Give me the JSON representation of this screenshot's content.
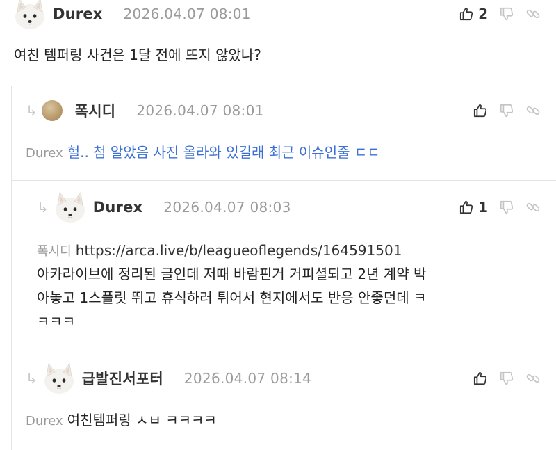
{
  "comments": [
    {
      "author": "Durex",
      "date": "2026.04.07 08:01",
      "like_count": "2",
      "text": "여친 템퍼링 사건은 1달 전에 뜨지 않았나?"
    },
    {
      "author": "폭시디",
      "date": "2026.04.07 08:01",
      "mention": "Durex",
      "text": "헐.. 첨 알았음 사진 올라와 있길래 최근 이슈인줄 ㄷㄷ"
    },
    {
      "author": "Durex",
      "date": "2026.04.07 08:03",
      "like_count": "1",
      "mention": "폭시디",
      "link": "https://arca.live/b/leagueoflegends/164591501",
      "lines": [
        "아카라이브에 정리된 글인데 저때 바람핀거 거피셜되고 2년 계약 박",
        "아놓고 1스플릿 뛰고 휴식하러 튀어서 현지에서도 반응 안좋던데 ㅋ",
        "ㅋㅋㅋ"
      ]
    },
    {
      "author": "급발진서포터",
      "date": "2026.04.07 08:14",
      "mention": "Durex",
      "text": "여친템퍼링 ㅅㅂ ㅋㅋㅋㅋ"
    }
  ],
  "icons": {
    "like": "thumbs-up-icon",
    "dislike": "thumbs-down-icon",
    "share": "link-icon",
    "reply": "reply-arrow-icon"
  },
  "colors": {
    "mention_text": "#3b6fd6",
    "muted": "#9a9a9a"
  }
}
